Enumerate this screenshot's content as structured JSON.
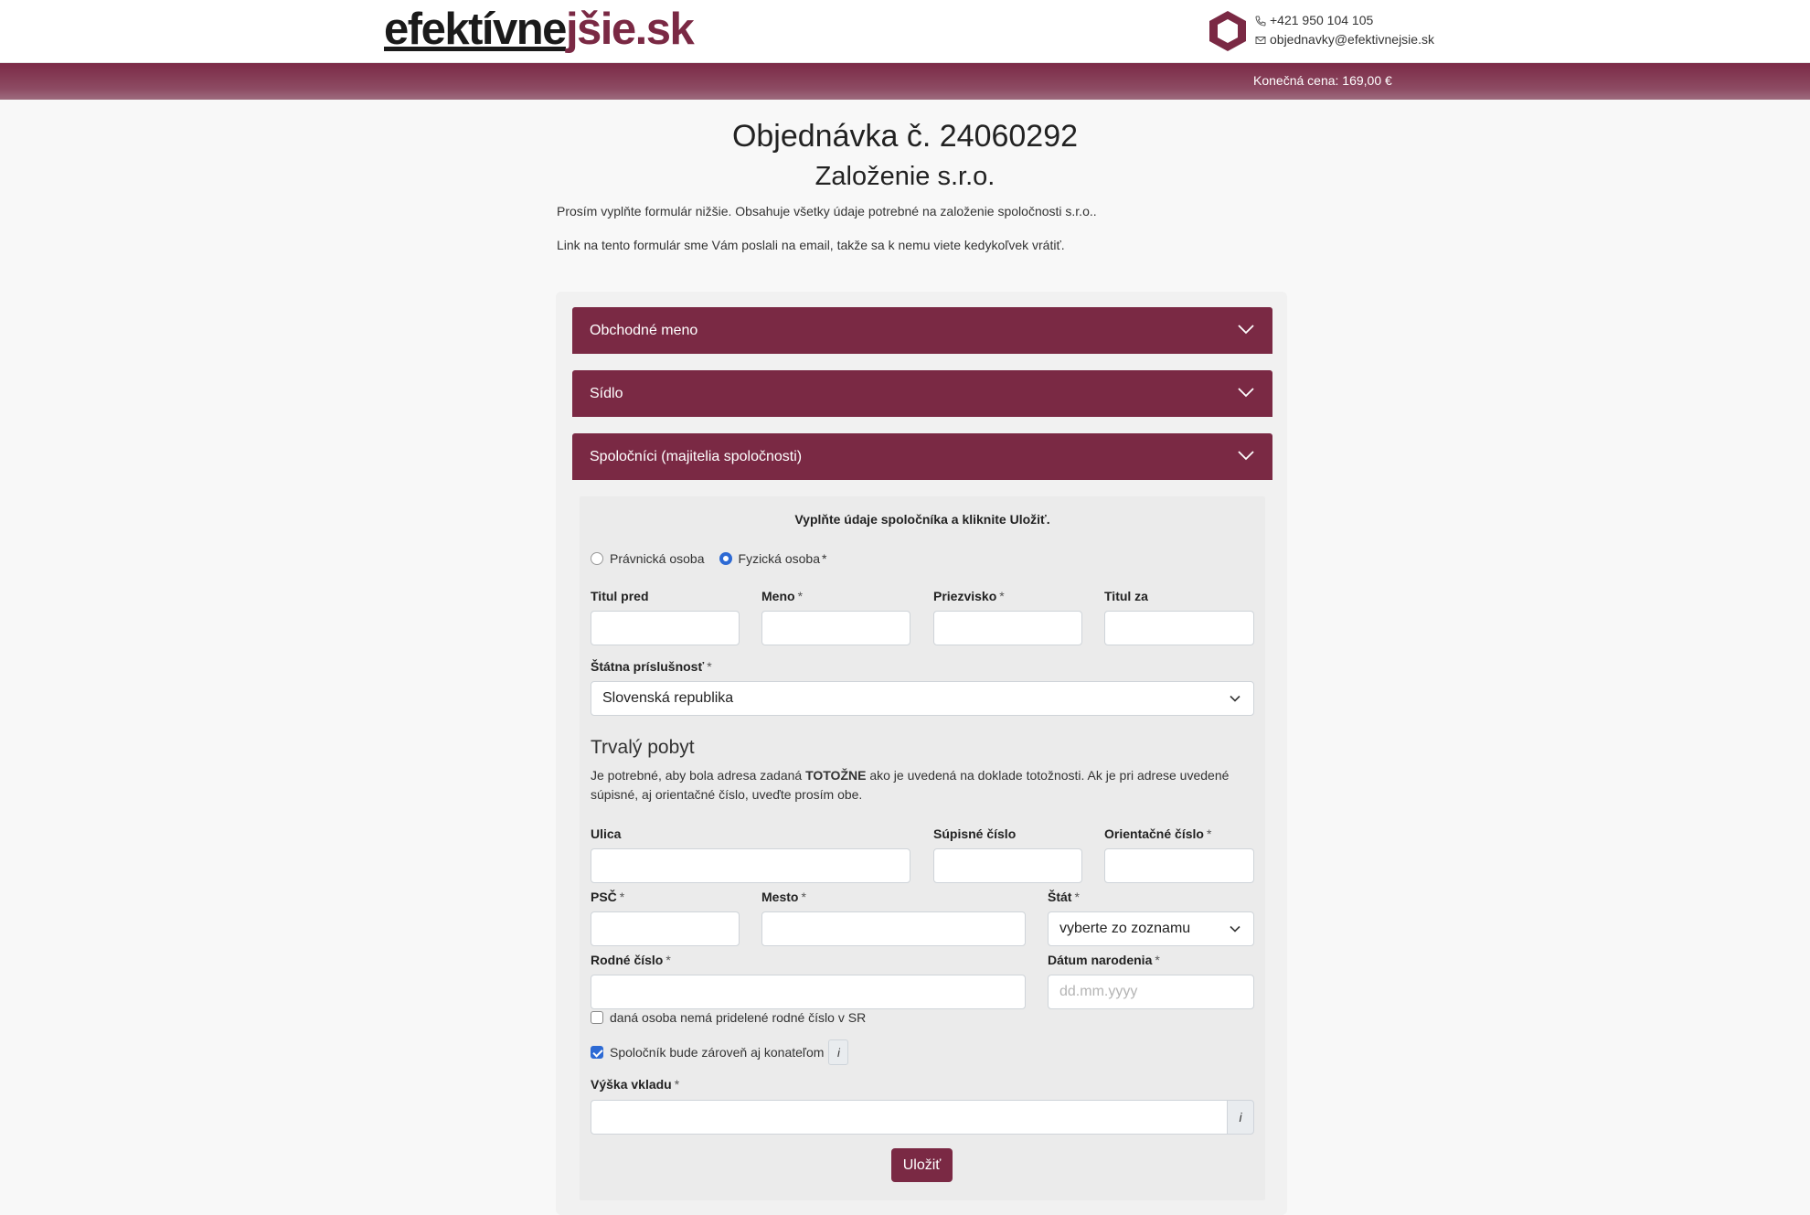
{
  "brand": {
    "part1": "efektívne",
    "part2": "jšie.sk",
    "accent": "#7a2944"
  },
  "contact": {
    "phone": "+421 950 104 105",
    "email": "objednavky@efektivnejsie.sk",
    "phone_icon": "phone-icon",
    "mail_icon": "envelope-icon"
  },
  "price_label": "Konečná cena: 169,00 €",
  "order_title": "Objednávka č. 24060292",
  "service_title": "Založenie s.r.o.",
  "intro_1": "Prosím vyplňte formulár nižšie. Obsahuje všetky údaje potrebné na založenie spoločnosti s.r.o..",
  "intro_2": "Link na tento formulár sme Vám poslali na email, takže sa k nemu viete kedykoľvek vrátiť.",
  "sections": [
    {
      "label": "Obchodné meno"
    },
    {
      "label": "Sídlo"
    },
    {
      "label": "Spoločníci (majitelia spoločnosti)"
    }
  ],
  "form": {
    "notice": "Vyplňte údaje spoločníka a kliknite Uložiť.",
    "person_type": {
      "legal": "Právnická osoba",
      "natural": "Fyzická osoba",
      "selected": "natural"
    },
    "required_mark": "*",
    "title_before": {
      "label": "Titul pred",
      "value": ""
    },
    "first_name": {
      "label": "Meno",
      "value": ""
    },
    "last_name": {
      "label": "Priezvisko",
      "value": ""
    },
    "title_after": {
      "label": "Titul za",
      "value": ""
    },
    "nationality": {
      "label": "Štátna príslušnosť",
      "value": "Slovenská republika"
    },
    "residence_heading": "Trvalý pobyt",
    "residence_note_a": "Je potrebné, aby bola adresa zadaná ",
    "residence_note_b": "TOTOŽNE",
    "residence_note_c": " ako je uvedená na doklade totožnosti. Ak je pri adrese uvedené súpisné, aj orientačné číslo, uveďte prosím obe.",
    "street": {
      "label": "Ulica",
      "value": ""
    },
    "house_no": {
      "label": "Súpisné číslo",
      "value": ""
    },
    "orient_no": {
      "label": "Orientačné číslo",
      "value": ""
    },
    "zip": {
      "label": "PSČ",
      "value": ""
    },
    "city": {
      "label": "Mesto",
      "value": ""
    },
    "country": {
      "label": "Štát",
      "value": "vyberte zo zoznamu"
    },
    "birth_no": {
      "label": "Rodné číslo",
      "value": ""
    },
    "birth_date": {
      "label": "Dátum narodenia",
      "placeholder": "dd.mm.yyyy"
    },
    "no_birth_no": {
      "label": "daná osoba nemá pridelené rodné číslo v SR",
      "checked": false
    },
    "is_executive": {
      "label": "Spoločník bude zároveň aj konateľom",
      "checked": true
    },
    "info_glyph": "i",
    "deposit": {
      "label": "Výška vkladu",
      "value": ""
    },
    "save_label": "Uložiť"
  }
}
